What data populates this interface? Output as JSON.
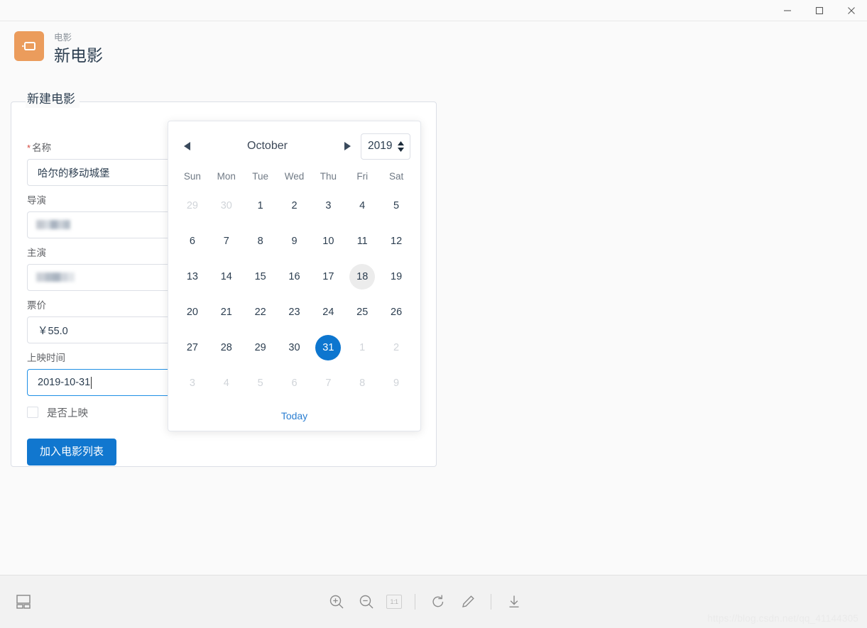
{
  "window": {
    "controls": [
      {
        "name": "minimize",
        "glyph": "minimize-icon"
      },
      {
        "name": "maximize",
        "glyph": "maximize-icon"
      },
      {
        "name": "close",
        "glyph": "close-icon"
      }
    ]
  },
  "header": {
    "icon": "movie-screen-icon",
    "icon_color": "#eb9c5c",
    "breadcrumb": "电影",
    "title": "新电影"
  },
  "form": {
    "legend": "新建电影",
    "fields": {
      "name": {
        "label": "名称",
        "required": true,
        "required_marker": "*",
        "value": "哈尔的移动城堡"
      },
      "director": {
        "label": "导演",
        "required": false,
        "value": "",
        "redacted": true
      },
      "actor": {
        "label": "主演",
        "required": false,
        "value": "",
        "redacted": true
      },
      "price": {
        "label": "票价",
        "required": false,
        "value": "￥55.0"
      },
      "release_date": {
        "label": "上映时间",
        "required": false,
        "value": "2019-10-31",
        "focused": true,
        "icon": "calendar-icon"
      }
    },
    "checkbox": {
      "label": "是否上映",
      "checked": false
    },
    "submit_label": "加入电影列表",
    "submit_color": "#1177cf"
  },
  "datepicker": {
    "prev_icon": "triangle-left-icon",
    "next_icon": "triangle-right-icon",
    "month": "October",
    "year": "2019",
    "spinner_up_icon": "caret-up-icon",
    "spinner_down_icon": "caret-down-icon",
    "weekdays": [
      "Sun",
      "Mon",
      "Tue",
      "Wed",
      "Thu",
      "Fri",
      "Sat"
    ],
    "weeks": [
      [
        {
          "day": "29",
          "state": "muted"
        },
        {
          "day": "30",
          "state": "muted"
        },
        {
          "day": "1",
          "state": "normal"
        },
        {
          "day": "2",
          "state": "normal"
        },
        {
          "day": "3",
          "state": "normal"
        },
        {
          "day": "4",
          "state": "normal"
        },
        {
          "day": "5",
          "state": "normal"
        }
      ],
      [
        {
          "day": "6",
          "state": "normal"
        },
        {
          "day": "7",
          "state": "normal"
        },
        {
          "day": "8",
          "state": "normal"
        },
        {
          "day": "9",
          "state": "normal"
        },
        {
          "day": "10",
          "state": "normal"
        },
        {
          "day": "11",
          "state": "normal"
        },
        {
          "day": "12",
          "state": "normal"
        }
      ],
      [
        {
          "day": "13",
          "state": "normal"
        },
        {
          "day": "14",
          "state": "normal"
        },
        {
          "day": "15",
          "state": "normal"
        },
        {
          "day": "16",
          "state": "normal"
        },
        {
          "day": "17",
          "state": "normal"
        },
        {
          "day": "18",
          "state": "hovered"
        },
        {
          "day": "19",
          "state": "normal"
        }
      ],
      [
        {
          "day": "20",
          "state": "normal"
        },
        {
          "day": "21",
          "state": "normal"
        },
        {
          "day": "22",
          "state": "normal"
        },
        {
          "day": "23",
          "state": "normal"
        },
        {
          "day": "24",
          "state": "normal"
        },
        {
          "day": "25",
          "state": "normal"
        },
        {
          "day": "26",
          "state": "normal"
        }
      ],
      [
        {
          "day": "27",
          "state": "normal"
        },
        {
          "day": "28",
          "state": "normal"
        },
        {
          "day": "29",
          "state": "normal"
        },
        {
          "day": "30",
          "state": "normal"
        },
        {
          "day": "31",
          "state": "selected"
        },
        {
          "day": "1",
          "state": "muted"
        },
        {
          "day": "2",
          "state": "muted"
        }
      ],
      [
        {
          "day": "3",
          "state": "muted"
        },
        {
          "day": "4",
          "state": "muted"
        },
        {
          "day": "5",
          "state": "muted"
        },
        {
          "day": "6",
          "state": "muted"
        },
        {
          "day": "7",
          "state": "muted"
        },
        {
          "day": "8",
          "state": "muted"
        },
        {
          "day": "9",
          "state": "muted"
        }
      ]
    ],
    "today_label": "Today",
    "today_color": "#2a7ed1",
    "selected_color": "#0d76cf"
  },
  "toolbar": {
    "layout_icon": "layout-panel-icon",
    "items": [
      {
        "name": "zoom-in",
        "icon": "zoom-in-icon"
      },
      {
        "name": "zoom-out",
        "icon": "zoom-out-icon"
      },
      {
        "name": "actual-size",
        "icon": "one-to-one-icon",
        "label": "1:1"
      },
      {
        "name": "separator-1",
        "icon": "divider"
      },
      {
        "name": "rotate",
        "icon": "rotate-cw-icon"
      },
      {
        "name": "edit",
        "icon": "pencil-icon"
      },
      {
        "name": "separator-2",
        "icon": "divider"
      },
      {
        "name": "download",
        "icon": "download-icon"
      }
    ]
  },
  "watermark": "https://blog.csdn.net/qq_41144305"
}
